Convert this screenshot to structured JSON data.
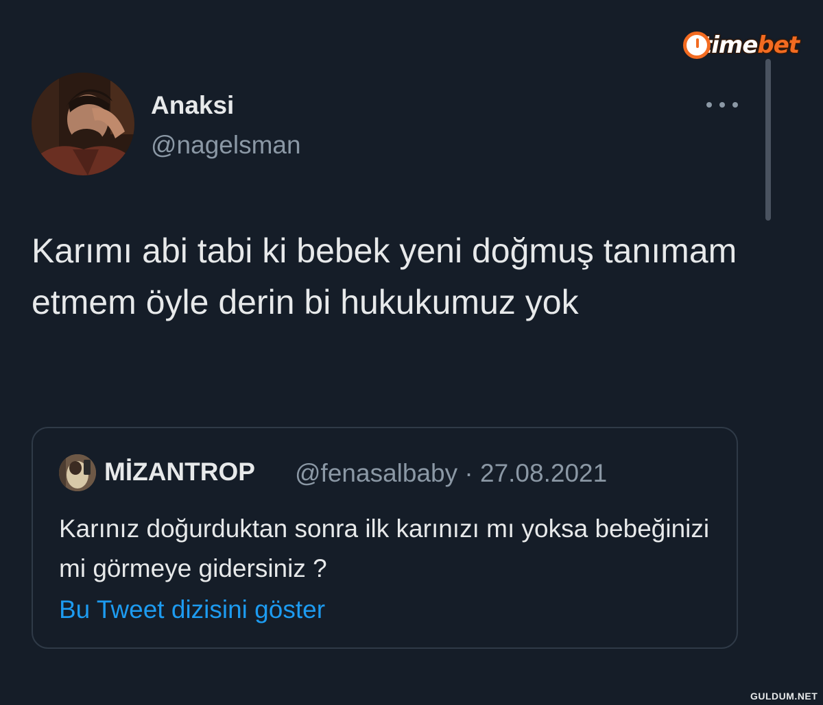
{
  "watermark": {
    "logo_part_1": "time",
    "logo_part_2": "bet",
    "site": "GULDUM.NET"
  },
  "tweet": {
    "author": {
      "display_name": "Anaksi",
      "handle": "@nagelsman",
      "avatar_icon": "profile-photo"
    },
    "more_icon": "more-horizontal-icon",
    "text": "Karımı abi tabi ki bebek yeni doğmuş tanımam etmem öyle derin bi hukukumuz yok"
  },
  "quote": {
    "author": {
      "display_name": "MİZANTROP",
      "handle": "@fenasalbaby",
      "separator": "·",
      "date": "27.08.2021",
      "avatar_icon": "profile-photo"
    },
    "text": "Karınız doğurduktan sonra ilk karınızı mı yoksa bebeğinizi mi görmeye gidersiniz ?",
    "show_thread_label": "Bu Tweet dizisini göster"
  },
  "colors": {
    "background": "#151d28",
    "primary_text": "#e7e9ea",
    "secondary_text": "#8b98a5",
    "link": "#1d9bf0",
    "card_border": "#2f3a47",
    "logo_accent": "#f26b21"
  }
}
